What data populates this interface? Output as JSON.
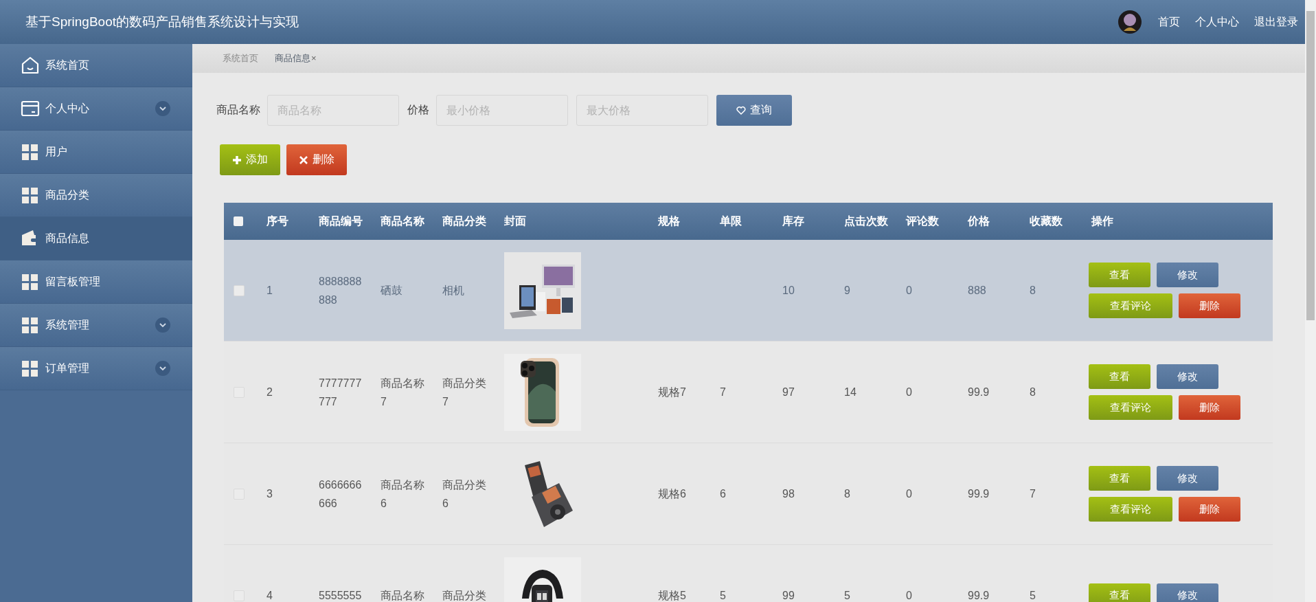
{
  "header": {
    "title": "基于SpringBoot的数码产品销售系统设计与实现",
    "links": [
      "首页",
      "个人中心",
      "退出登录"
    ]
  },
  "sidebar": {
    "items": [
      {
        "label": "系统首页",
        "selected": false,
        "expandable": false
      },
      {
        "label": "个人中心",
        "selected": false,
        "expandable": true
      },
      {
        "label": "用户",
        "selected": false,
        "expandable": false
      },
      {
        "label": "商品分类",
        "selected": false,
        "expandable": false
      },
      {
        "label": "商品信息",
        "selected": true,
        "expandable": false
      },
      {
        "label": "留言板管理",
        "selected": false,
        "expandable": false
      },
      {
        "label": "系统管理",
        "selected": false,
        "expandable": true
      },
      {
        "label": "订单管理",
        "selected": false,
        "expandable": true
      }
    ]
  },
  "breadcrumb": [
    {
      "label": "系统首页",
      "selected": false
    },
    {
      "label": "商品信息",
      "selected": true,
      "close": "×"
    }
  ],
  "search": {
    "name_label": "商品名称",
    "name_placeholder": "商品名称",
    "price_label": "价格",
    "min_placeholder": "最小价格",
    "max_placeholder": "最大价格",
    "button": "查询"
  },
  "actions": [
    {
      "kind": "add",
      "label": "添加"
    },
    {
      "kind": "delete",
      "label": "删除"
    }
  ],
  "table": {
    "select_all_checked": false,
    "columns": [
      "序号",
      "商品编号",
      "商品名称",
      "商品分类",
      "封面",
      "规格",
      "单限",
      "库存",
      "点击次数",
      "评论数",
      "价格",
      "收藏数",
      "操作"
    ],
    "rows": [
      {
        "highlighted": true,
        "checked": false,
        "cells": [
          "1",
          "8888888888",
          "硒鼓",
          "相机",
          null,
          null,
          null,
          "10",
          "9",
          "0",
          "888",
          "8"
        ],
        "buttons": [
          "查看",
          "修改",
          "查看评论",
          "删除"
        ]
      },
      {
        "highlighted": false,
        "checked": false,
        "cells": [
          "2",
          "7777777777",
          "商品名称7",
          "商品分类7",
          null,
          "规格7",
          "7",
          "97",
          "14",
          "0",
          "99.9",
          "8"
        ],
        "buttons": [
          "查看",
          "修改",
          "查看评论",
          "删除"
        ]
      },
      {
        "highlighted": false,
        "checked": false,
        "cells": [
          "3",
          "6666666666",
          "商品名称6",
          "商品分类6",
          null,
          "规格6",
          "6",
          "98",
          "8",
          "0",
          "99.9",
          "7"
        ],
        "buttons": [
          "查看",
          "修改",
          "查看评论",
          "删除"
        ]
      },
      {
        "highlighted": false,
        "checked": false,
        "cells": [
          "4",
          "5555555",
          "商品名称",
          "商品分类",
          null,
          "规格5",
          "5",
          "99",
          "5",
          "0",
          "99.9",
          "5"
        ],
        "buttons": [
          "查看",
          "修改"
        ]
      }
    ]
  }
}
